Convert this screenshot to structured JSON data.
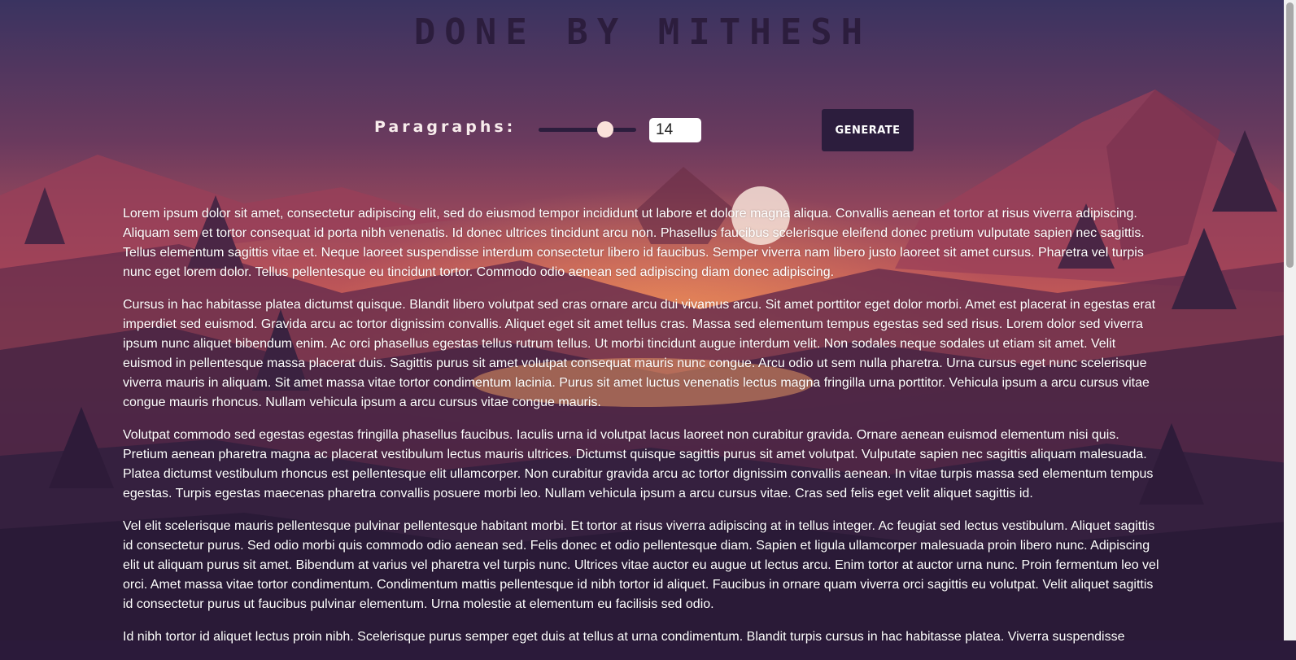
{
  "page": {
    "title": "DONE BY MITHESH"
  },
  "controls": {
    "paragraphs_label": "Paragraphs:",
    "slider_value": 14,
    "slider_min": 1,
    "slider_max": 20,
    "count_value": "14",
    "generate_label": "GENERATE"
  },
  "paragraphs": [
    "Lorem ipsum dolor sit amet, consectetur adipiscing elit, sed do eiusmod tempor incididunt ut labore et dolore magna aliqua. Convallis aenean et tortor at risus viverra adipiscing. Aliquam sem et tortor consequat id porta nibh venenatis. Id donec ultrices tincidunt arcu non. Phasellus faucibus scelerisque eleifend donec pretium vulputate sapien nec sagittis. Tellus elementum sagittis vitae et. Neque laoreet suspendisse interdum consectetur libero id faucibus. Semper viverra nam libero justo laoreet sit amet cursus. Pharetra vel turpis nunc eget lorem dolor. Tellus pellentesque eu tincidunt tortor. Commodo odio aenean sed adipiscing diam donec adipiscing.",
    "Cursus in hac habitasse platea dictumst quisque. Blandit libero volutpat sed cras ornare arcu dui vivamus arcu. Sit amet porttitor eget dolor morbi. Amet est placerat in egestas erat imperdiet sed euismod. Gravida arcu ac tortor dignissim convallis. Aliquet eget sit amet tellus cras. Massa sed elementum tempus egestas sed sed risus. Lorem dolor sed viverra ipsum nunc aliquet bibendum enim. Ac orci phasellus egestas tellus rutrum tellus. Ut morbi tincidunt augue interdum velit. Non sodales neque sodales ut etiam sit amet. Velit euismod in pellentesque massa placerat duis. Sagittis purus sit amet volutpat consequat mauris nunc congue. Arcu odio ut sem nulla pharetra. Urna cursus eget nunc scelerisque viverra mauris in aliquam. Sit amet massa vitae tortor condimentum lacinia. Purus sit amet luctus venenatis lectus magna fringilla urna porttitor. Vehicula ipsum a arcu cursus vitae congue mauris rhoncus. Nullam vehicula ipsum a arcu cursus vitae congue mauris.",
    "Volutpat commodo sed egestas egestas fringilla phasellus faucibus. Iaculis urna id volutpat lacus laoreet non curabitur gravida. Ornare aenean euismod elementum nisi quis. Pretium aenean pharetra magna ac placerat vestibulum lectus mauris ultrices. Dictumst quisque sagittis purus sit amet volutpat. Vulputate sapien nec sagittis aliquam malesuada. Platea dictumst vestibulum rhoncus est pellentesque elit ullamcorper. Non curabitur gravida arcu ac tortor dignissim convallis aenean. In vitae turpis massa sed elementum tempus egestas. Turpis egestas maecenas pharetra convallis posuere morbi leo. Nullam vehicula ipsum a arcu cursus vitae. Cras sed felis eget velit aliquet sagittis id.",
    "Vel elit scelerisque mauris pellentesque pulvinar pellentesque habitant morbi. Et tortor at risus viverra adipiscing at in tellus integer. Ac feugiat sed lectus vestibulum. Aliquet sagittis id consectetur purus. Sed odio morbi quis commodo odio aenean sed. Felis donec et odio pellentesque diam. Sapien et ligula ullamcorper malesuada proin libero nunc. Adipiscing elit ut aliquam purus sit amet. Bibendum at varius vel pharetra vel turpis nunc. Ultrices vitae auctor eu augue ut lectus arcu. Enim tortor at auctor urna nunc. Proin fermentum leo vel orci. Amet massa vitae tortor condimentum. Condimentum mattis pellentesque id nibh tortor id aliquet. Faucibus in ornare quam viverra orci sagittis eu volutpat. Velit aliquet sagittis id consectetur purus ut faucibus pulvinar elementum. Urna molestie at elementum eu facilisis sed odio.",
    "Id nibh tortor id aliquet lectus proin nibh. Scelerisque purus semper eget duis at tellus at urna condimentum. Blandit turpis cursus in hac habitasse platea. Viverra suspendisse"
  ]
}
